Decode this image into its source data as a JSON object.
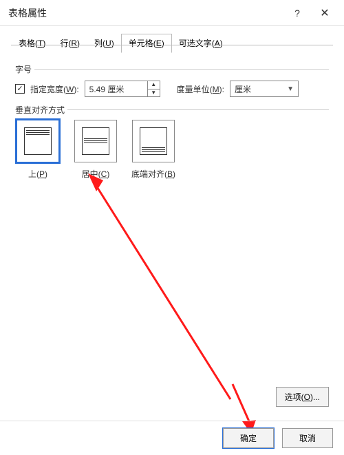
{
  "titlebar": {
    "title": "表格属性",
    "help": "?",
    "close": "✕"
  },
  "tabs": {
    "items": [
      {
        "label_pre": "表格(",
        "key": "T",
        "label_post": ")"
      },
      {
        "label_pre": "行(",
        "key": "R",
        "label_post": ")"
      },
      {
        "label_pre": "列(",
        "key": "U",
        "label_post": ")"
      },
      {
        "label_pre": "单元格(",
        "key": "E",
        "label_post": ")"
      },
      {
        "label_pre": "可选文字(",
        "key": "A",
        "label_post": ")"
      }
    ],
    "active": 3
  },
  "size_section": {
    "legend": "字号",
    "checkbox_label_pre": "指定宽度(",
    "checkbox_key": "W",
    "checkbox_label_post": "):",
    "width_value": "5.49 厘米",
    "unit_label_pre": "度量单位(",
    "unit_key": "M",
    "unit_label_post": "):",
    "unit_value": "厘米"
  },
  "valign_section": {
    "legend": "垂直对齐方式",
    "options": [
      {
        "label_pre": "上(",
        "key": "P",
        "label_post": ")",
        "mode": "top",
        "selected": true
      },
      {
        "label_pre": "居中(",
        "key": "C",
        "label_post": ")",
        "mode": "mid",
        "selected": false
      },
      {
        "label_pre": "底端对齐(",
        "key": "B",
        "label_post": ")",
        "mode": "bot",
        "selected": false
      }
    ]
  },
  "options_btn": {
    "label_pre": "选项(",
    "key": "O",
    "label_post": ")..."
  },
  "footer": {
    "ok": "确定",
    "cancel": "取消"
  }
}
